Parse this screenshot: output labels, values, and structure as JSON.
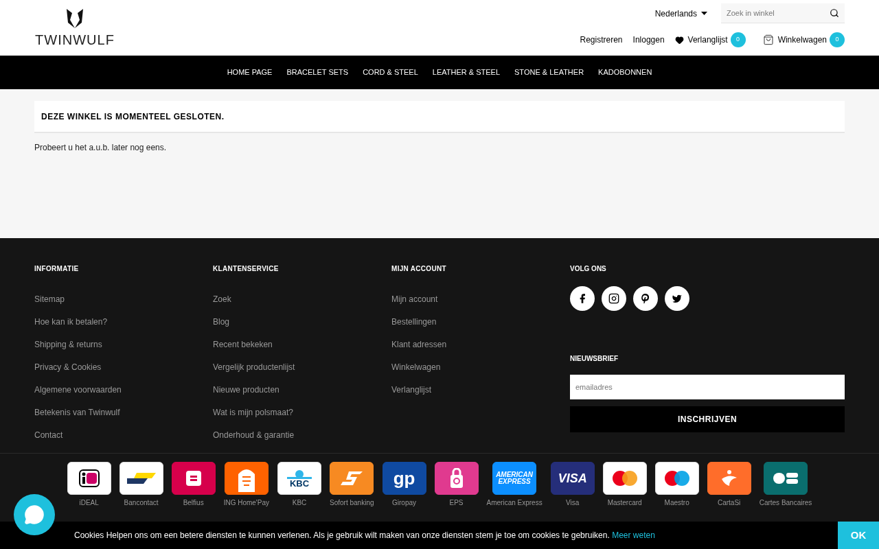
{
  "header": {
    "logo": "TWINWULF",
    "language": "Nederlands",
    "search": {
      "placeholder": "Zoek in winkel"
    },
    "links": [
      {
        "kind": "plain",
        "label": "Registreren"
      },
      {
        "kind": "plain",
        "label": "Inloggen"
      },
      {
        "kind": "wishlist",
        "label": "Verlanglijst",
        "count": "0"
      },
      {
        "kind": "cart",
        "label": "Winkelwagen",
        "count": "0"
      }
    ]
  },
  "nav": [
    "HOME PAGE",
    "BRACELET SETS",
    "CORD & STEEL",
    "LEATHER & STEEL",
    "STONE & LEATHER",
    "KADOBONNEN"
  ],
  "notice": {
    "title": "DEZE WINKEL IS MOMENTEEL GESLOTEN.",
    "text": "Probeert u het a.u.b. later nog eens."
  },
  "footer": {
    "columns": [
      {
        "title": "INFORMATIE",
        "links": [
          "Sitemap",
          "Hoe kan ik betalen?",
          "Shipping & returns",
          "Privacy & Cookies",
          "Algemene voorwaarden",
          "Betekenis van Twinwulf",
          "Contact"
        ]
      },
      {
        "title": "KLANTENSERVICE",
        "links": [
          "Zoek",
          "Blog",
          "Recent bekeken",
          "Vergelijk productenlijst",
          "Nieuwe producten",
          "Wat is mijn polsmaat?",
          "Onderhoud & garantie"
        ]
      },
      {
        "title": "MIJN ACCOUNT",
        "links": [
          "Mijn account",
          "Bestellingen",
          "Klant adressen",
          "Winkelwagen",
          "Verlanglijst"
        ]
      }
    ],
    "social": {
      "title": "VOLG ONS",
      "items": [
        {
          "kind": "facebook"
        },
        {
          "kind": "instagram"
        },
        {
          "kind": "pinterest"
        },
        {
          "kind": "twitter"
        }
      ]
    },
    "newsletter": {
      "title": "NIEUWSBRIEF",
      "placeholder": "emailadres",
      "button": "INSCHRIJVEN"
    }
  },
  "payments": [
    {
      "kind": "ideal",
      "label": "iDEAL",
      "color": "#ffffff"
    },
    {
      "kind": "bancontact",
      "label": "Bancontact",
      "color": "#ffffff"
    },
    {
      "kind": "belfius",
      "label": "Belfius",
      "color": "#d6004b"
    },
    {
      "kind": "ing",
      "label": "ING Home'Pay",
      "color": "#ff6200"
    },
    {
      "kind": "kbc",
      "label": "KBC",
      "color": "#ffffff",
      "logo_text": "KBC"
    },
    {
      "kind": "sofort",
      "label": "Sofort banking",
      "color": "#f78a22"
    },
    {
      "kind": "giropay",
      "label": "Giropay",
      "color": "#0f4aa1",
      "logo_text": "gp"
    },
    {
      "kind": "eps",
      "label": "EPS",
      "color": "#e03a8f"
    },
    {
      "kind": "amex",
      "label": "American Express",
      "color": "#0c8fff",
      "logo_text": "AMERICAN EXPRESS"
    },
    {
      "kind": "visa",
      "label": "Visa",
      "color": "#252e7a",
      "logo_text": "VISA"
    },
    {
      "kind": "mastercard",
      "label": "Mastercard",
      "color": "#ffffff"
    },
    {
      "kind": "maestro",
      "label": "Maestro",
      "color": "#ffffff"
    },
    {
      "kind": "cartasi",
      "label": "CartaSi",
      "color": "#ff6d2a"
    },
    {
      "kind": "cb",
      "label": "Cartes Bancaires",
      "color": "#0a6e6e"
    }
  ],
  "cookie_bar": {
    "text": "Cookies Helpen ons om een betere diensten te kunnen verlenen. Als je gebruik wilt maken van onze diensten stem je toe om cookies te gebruiken.",
    "link": "Meer weten",
    "button": "OK"
  }
}
